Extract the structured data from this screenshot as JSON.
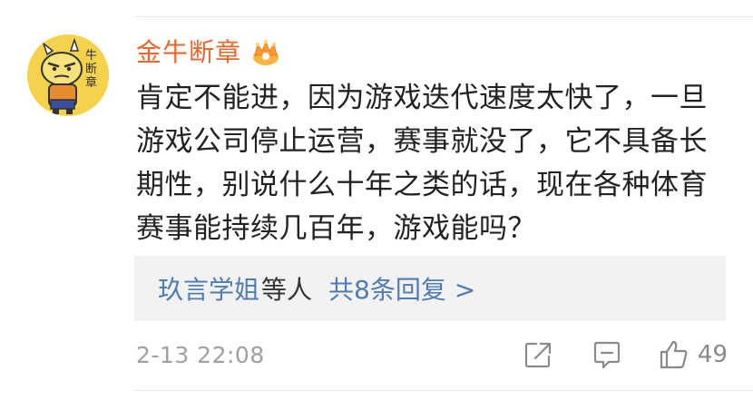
{
  "comment": {
    "username": "金牛断章",
    "badge_icon": "crown-badge-icon",
    "avatar_text": "牛断章",
    "text": "肯定不能进，因为游戏迭代速度太快了，一旦游戏公司停止运营，赛事就没了，它不具备长期性，别说什么十年之类的话，现在各种体育赛事能持续几百年，游戏能吗？",
    "replies": {
      "user": "玖言学姐",
      "others": "等人",
      "count_label": "共8条回复 >"
    },
    "timestamp": "2-13 22:08",
    "likes": "49"
  },
  "colors": {
    "username": "#e8672e",
    "link": "#4f7db3",
    "text": "#222222",
    "muted": "#a0a0a0",
    "reply_bg": "#f2f2f2"
  }
}
